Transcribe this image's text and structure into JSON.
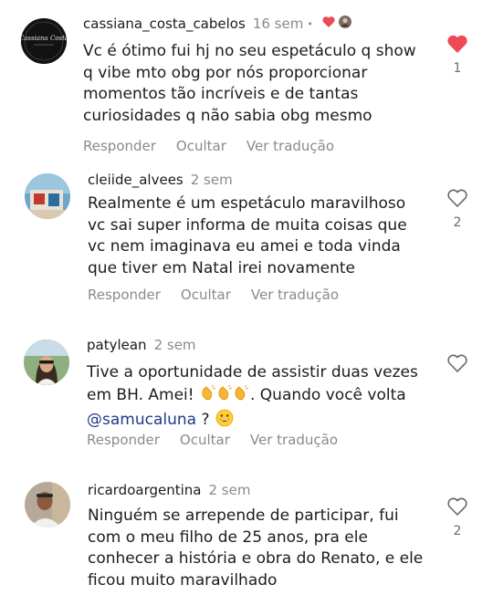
{
  "comments": [
    {
      "username": "cassiana_costa_cabelos",
      "time": "16 sem",
      "separator": "•",
      "avatar_text": "Cassiana Costa",
      "text": "Vc é ótimo fui hj no seu espetáculo q show\nq vibe mto obg por nós proporcionar\nmomentos tão incríveis e de tantas\ncuriosidades q não sabia obg mesmo",
      "actions": {
        "reply": "Responder",
        "hide": "Ocultar",
        "translate": "Ver tradução"
      },
      "likes": "1",
      "liked": true
    },
    {
      "username": "cleiide_alvees",
      "time": "2 sem",
      "text": "Realmente é um espetáculo maravilhoso\nvc sai super informa de muita coisas que\nvc nem imaginava eu amei e  toda vinda\nque tiver em Natal irei novamente",
      "actions": {
        "reply": "Responder",
        "hide": "Ocultar",
        "translate": "Ver tradução"
      },
      "likes": "2",
      "liked": false
    },
    {
      "username": "patylean",
      "time": "2 sem",
      "text_line1": "Tive a oportunidade de assistir duas vezes",
      "text_line2_a": "em BH. Amei!",
      "text_line2_b": ". Quando você volta",
      "mention": "@samucaluna",
      "text_line3_b": " ?",
      "emoji_clap": "clapping-hands",
      "emoji_smile": "grinning-face",
      "actions": {
        "reply": "Responder",
        "hide": "Ocultar",
        "translate": "Ver tradução"
      },
      "likes": "",
      "liked": false
    },
    {
      "username": "ricardoargentina",
      "time": "2 sem",
      "text": "Ninguém se arrepende de participar, fui\ncom o meu filho de 25 anos, pra ele\nconhecer a história e obra do Renato, e ele\nficou muito maravilhado",
      "likes": "2",
      "liked": false
    }
  ],
  "colors": {
    "liked_heart": "#ed4956",
    "muted_text": "#8a8a8a",
    "mention": "#1e3a8a"
  }
}
